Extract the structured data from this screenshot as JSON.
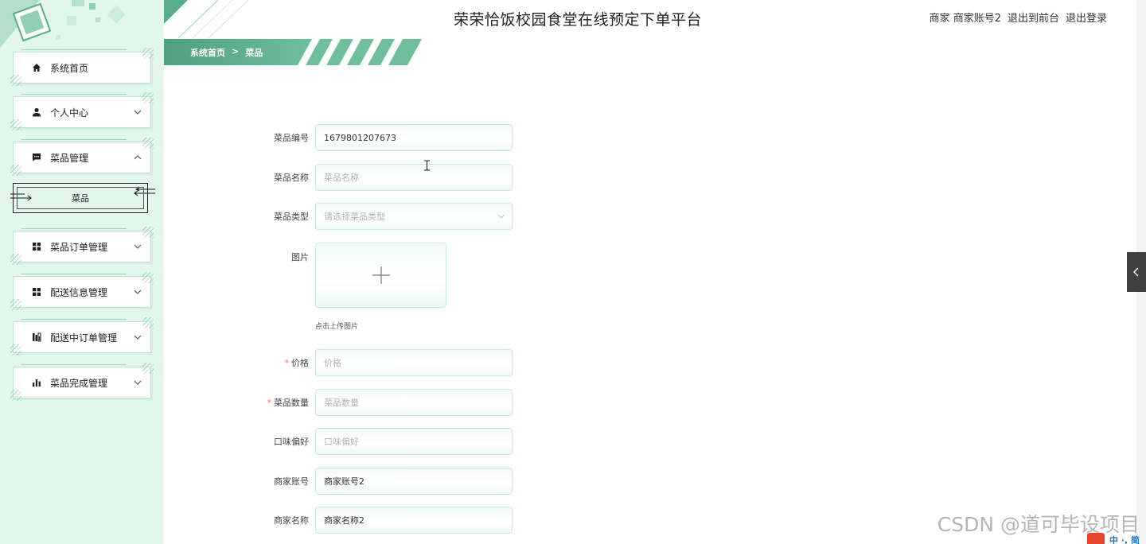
{
  "header": {
    "title": "荣荣恰饭校园食堂在线预定下单平台",
    "user_role": "商家",
    "user_name": "商家账号2",
    "back_to_front": "退出到前台",
    "logout": "退出登录"
  },
  "breadcrumb": {
    "home": "系统首页",
    "separator": ">",
    "current": "菜品"
  },
  "sidebar": {
    "items": [
      {
        "label": "系统首页",
        "icon": "home-icon"
      },
      {
        "label": "个人中心",
        "icon": "user-icon"
      },
      {
        "label": "菜品管理",
        "icon": "message-icon"
      },
      {
        "label": "菜品订单管理",
        "icon": "grid-icon"
      },
      {
        "label": "配送信息管理",
        "icon": "grid-icon"
      },
      {
        "label": "配送中订单管理",
        "icon": "chart-icon"
      },
      {
        "label": "菜品完成管理",
        "icon": "bar-chart-icon"
      }
    ],
    "sub_item": {
      "label": "菜品"
    }
  },
  "form": {
    "dish_no": {
      "label": "菜品编号",
      "value": "1679801207673"
    },
    "dish_name": {
      "label": "菜品名称",
      "placeholder": "菜品名称"
    },
    "dish_type": {
      "label": "菜品类型",
      "placeholder": "请选择菜品类型"
    },
    "image": {
      "label": "图片",
      "tip": "点击上传图片"
    },
    "price": {
      "label": "价格",
      "required_mark": "*",
      "placeholder": "价格"
    },
    "quantity": {
      "label": "菜品数量",
      "required_mark": "*",
      "placeholder": "菜品数量"
    },
    "taste": {
      "label": "口味偏好",
      "placeholder": "口味偏好"
    },
    "merchant_account": {
      "label": "商家账号",
      "value": "商家账号2"
    },
    "merchant_name": {
      "label": "商家名称",
      "value": "商家名称2"
    }
  },
  "watermark": "CSDN @道可毕设项目",
  "tray_text": "中 ·, 简",
  "colors": {
    "accent": "#5aae8c",
    "sidebar_bg": "#e3f6ee",
    "required": "#f56c6c"
  }
}
